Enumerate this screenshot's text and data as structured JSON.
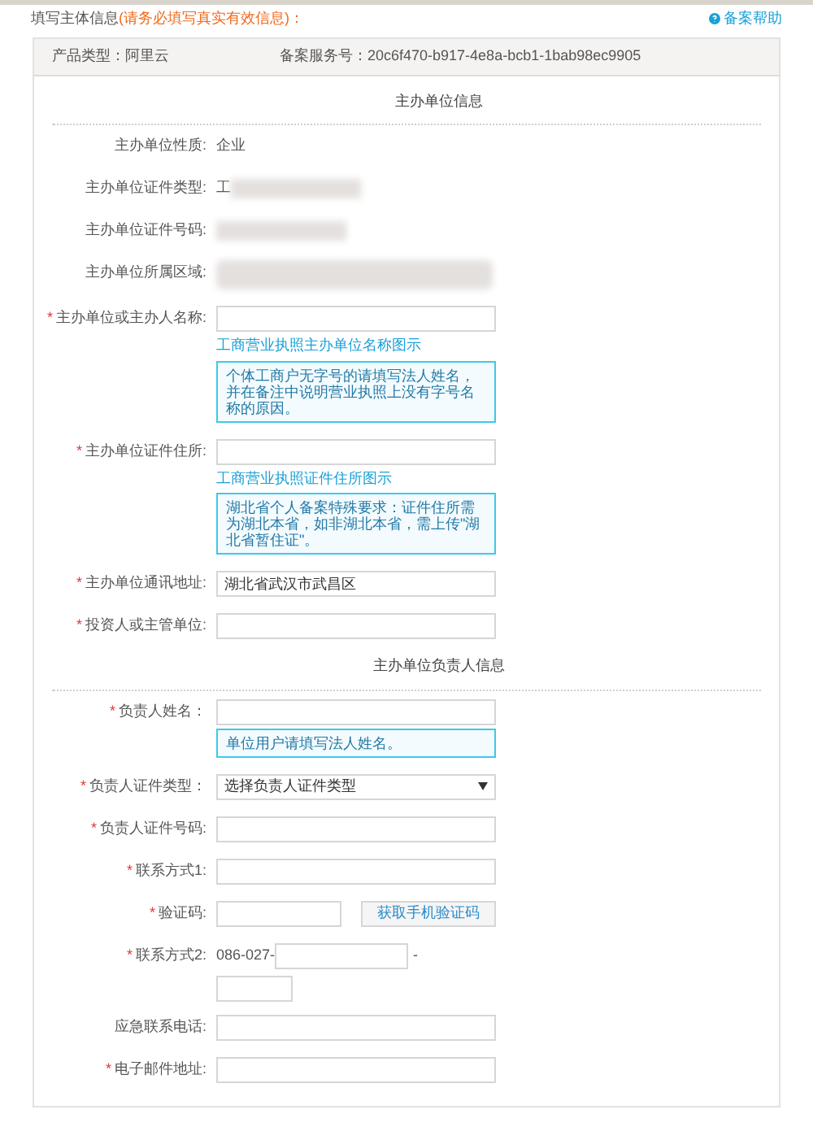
{
  "header": {
    "title": "填写主体信息",
    "notice": "(请务必填写真实有效信息)：",
    "help_link": "备案帮助"
  },
  "info_bar": {
    "product_label": "产品类型：",
    "product_value": "阿里云",
    "service_label": "备案服务号：",
    "service_value": "20c6f470-b917-4e8a-bcb1-1bab98ec9905"
  },
  "sections": [
    {
      "title": "主办单位信息",
      "fields": [
        {
          "kind": "text",
          "label": "主办单位性质:",
          "value": "企业"
        },
        {
          "kind": "redacted",
          "label": "主办单位证件类型:",
          "value": "工"
        },
        {
          "kind": "redacted",
          "label": "主办单位证件号码:"
        },
        {
          "kind": "redacted",
          "label": "主办单位所属区域:"
        },
        {
          "kind": "input",
          "label": "主办单位或主办人名称:",
          "mark": "*",
          "link": "工商营业执照主办单位名称图示",
          "note": "个体工商户无字号的请填写法人姓名，并在备注中说明营业执照上没有字号名称的原因。"
        },
        {
          "kind": "input",
          "label": "主办单位证件住所:",
          "mark": "*",
          "link": "工商营业执照证件住所图示",
          "note": "湖北省个人备案特殊要求：证件住所需为湖北本省，如非湖北本省，需上传\"湖北省暂住证\"。"
        },
        {
          "kind": "input",
          "label": "主办单位通讯地址:",
          "mark": "*",
          "value": "湖北省武汉市武昌区"
        },
        {
          "kind": "input",
          "label": "投资人或主管单位:",
          "mark": "*"
        }
      ]
    },
    {
      "title": "主办单位负责人信息",
      "fields": [
        {
          "kind": "input",
          "label": "负责人姓名：",
          "mark": "*",
          "note": "单位用户请填写法人姓名。"
        },
        {
          "kind": "select",
          "label": "负责人证件类型：",
          "mark": "*",
          "value": "选择负责人证件类型"
        },
        {
          "kind": "input",
          "label": "负责人证件号码:",
          "mark": "*"
        },
        {
          "kind": "input",
          "label": "联系方式1:",
          "mark": "*"
        },
        {
          "kind": "captcha",
          "label": "验证码:",
          "mark": "*",
          "button": "获取手机验证码"
        },
        {
          "kind": "phone",
          "label": "联系方式2:",
          "mark": "*",
          "prefix": "086-027-",
          "separator": "-"
        },
        {
          "kind": "input",
          "label": "应急联系电话:"
        },
        {
          "kind": "input",
          "label": "电子邮件地址:",
          "mark": "*"
        }
      ]
    }
  ]
}
